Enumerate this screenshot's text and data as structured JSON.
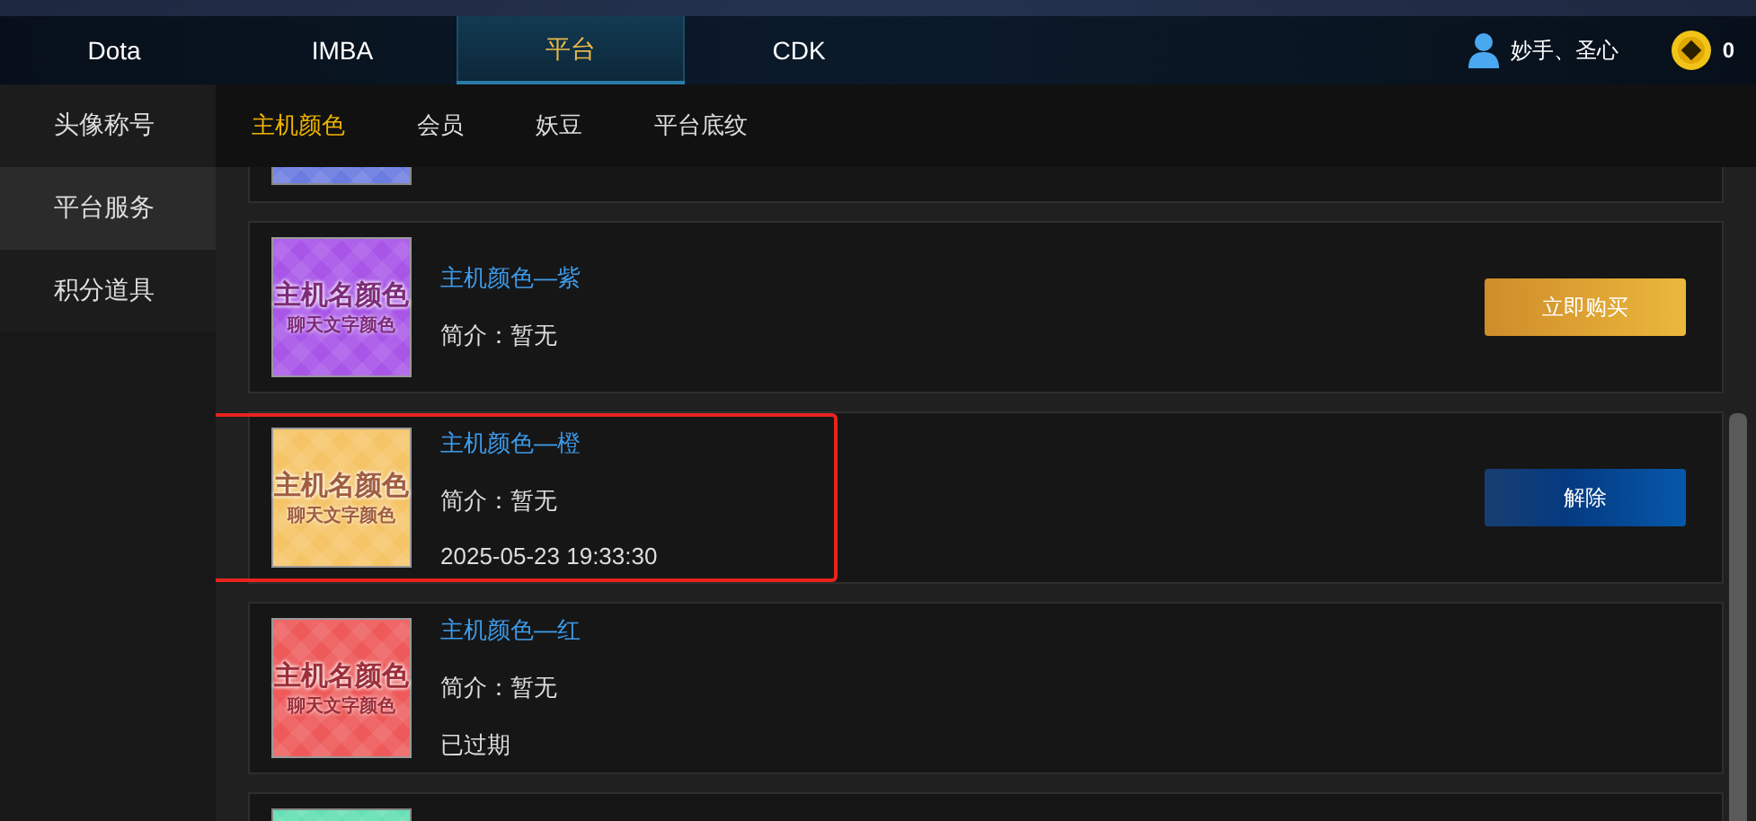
{
  "nav": {
    "tabs": [
      {
        "label": "Dota",
        "selected": false
      },
      {
        "label": "IMBA",
        "selected": false
      },
      {
        "label": "平台",
        "selected": true
      },
      {
        "label": "CDK",
        "selected": false
      }
    ],
    "user": "妙手、圣心",
    "coins": "0"
  },
  "sidebar": {
    "items": [
      {
        "label": "头像称号",
        "selected": false
      },
      {
        "label": "平台服务",
        "selected": true
      },
      {
        "label": "积分道具",
        "selected": false
      }
    ]
  },
  "subtabs": [
    {
      "label": "主机颜色",
      "selected": true
    },
    {
      "label": "会员",
      "selected": false
    },
    {
      "label": "妖豆",
      "selected": false
    },
    {
      "label": "平台底纹",
      "selected": false
    }
  ],
  "items": [
    {
      "kind": "partial_top",
      "color": "#6a7ce0"
    },
    {
      "kind": "full",
      "color": "#a855e8",
      "thumb_title": "主机名颜色",
      "thumb_subtitle": "聊天文字颜色",
      "title": "主机颜色—紫",
      "description": "简介：暂无",
      "button": {
        "kind": "buy",
        "label": "立即购买"
      },
      "highlighted": false
    },
    {
      "kind": "full",
      "color": "#f5c466",
      "thumb_title": "主机名颜色",
      "thumb_subtitle": "聊天文字颜色",
      "title": "主机颜色—橙",
      "description": "简介：暂无",
      "status": "2025-05-23 19:33:30",
      "button": {
        "kind": "remove",
        "label": "解除"
      },
      "highlighted": true
    },
    {
      "kind": "full",
      "color": "#ee5a5a",
      "thumb_title": "主机名颜色",
      "thumb_subtitle": "聊天文字颜色",
      "title": "主机颜色—红",
      "description": "简介：暂无",
      "status": "已过期",
      "highlighted": false
    },
    {
      "kind": "partial_bottom",
      "color": "#66e0b4"
    }
  ]
}
